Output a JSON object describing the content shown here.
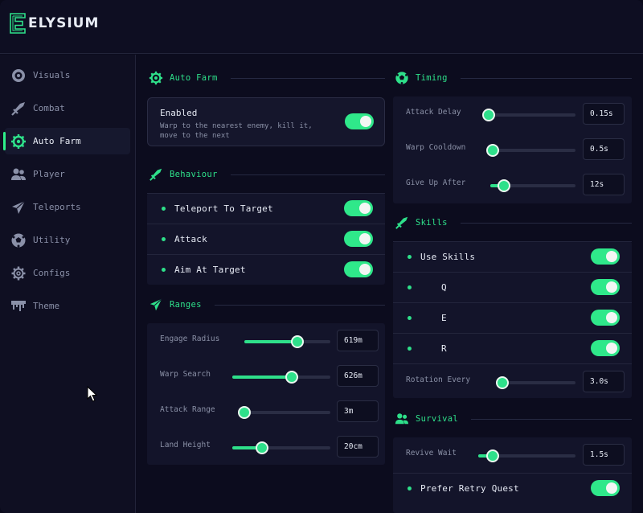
{
  "app": {
    "name": "ELYSIUM",
    "accent": "#2ee08a"
  },
  "sidebar": {
    "items": [
      {
        "label": "Visuals",
        "icon": "eye-ring-icon"
      },
      {
        "label": "Combat",
        "icon": "sword-icon"
      },
      {
        "label": "Auto Farm",
        "icon": "gear-icon",
        "active": true
      },
      {
        "label": "Player",
        "icon": "users-icon"
      },
      {
        "label": "Teleports",
        "icon": "paper-plane-icon"
      },
      {
        "label": "Utility",
        "icon": "ball-icon"
      },
      {
        "label": "Configs",
        "icon": "cog-icon"
      },
      {
        "label": "Theme",
        "icon": "paint-drip-icon"
      }
    ]
  },
  "autofarm": {
    "title": "Auto Farm",
    "enabled_label": "Enabled",
    "enabled_desc": "Warp to the nearest enemy, kill it, move to the next",
    "enabled": true
  },
  "behaviour": {
    "title": "Behaviour",
    "items": [
      {
        "label": "Teleport To Target",
        "on": true
      },
      {
        "label": "Attack",
        "on": true
      },
      {
        "label": "Aim At Target",
        "on": true
      }
    ]
  },
  "ranges": {
    "title": "Ranges",
    "sliders": [
      {
        "label": "Engage Radius",
        "value": "619m",
        "fraction": 0.62
      },
      {
        "label": "Warp Search",
        "value": "626m",
        "fraction": 0.61
      },
      {
        "label": "Attack Range",
        "value": "3m",
        "fraction": 0.0
      },
      {
        "label": "Land Height",
        "value": "20cm",
        "fraction": 0.3
      }
    ]
  },
  "timing": {
    "title": "Timing",
    "sliders": [
      {
        "label": "Attack Delay",
        "value": "0.15s",
        "fraction": 0.0
      },
      {
        "label": "Warp Cooldown",
        "value": "0.5s",
        "fraction": 0.0
      },
      {
        "label": "Give Up After",
        "value": "12s",
        "fraction": 0.16
      }
    ]
  },
  "skills": {
    "title": "Skills",
    "items": [
      {
        "label": "Use Skills",
        "on": true
      },
      {
        "label": "Q",
        "on": true
      },
      {
        "label": "E",
        "on": true
      },
      {
        "label": "R",
        "on": true
      }
    ],
    "rotation": {
      "label": "Rotation Every",
      "value": "3.0s",
      "fraction": 0.0
    }
  },
  "survival": {
    "title": "Survival",
    "revive": {
      "label": "Revive Wait",
      "value": "1.5s",
      "fraction": 0.15
    },
    "prefer": {
      "label": "Prefer Retry Quest",
      "on": true
    }
  }
}
